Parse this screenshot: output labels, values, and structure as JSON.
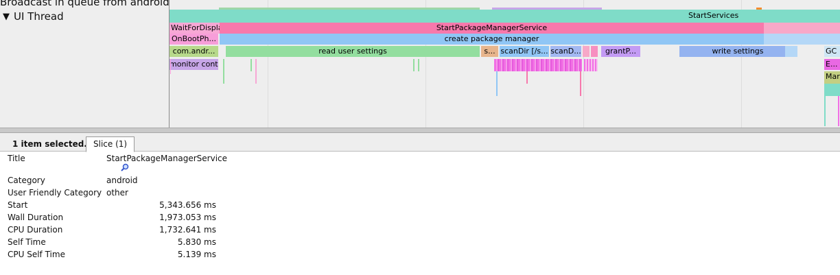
{
  "track_header": {
    "previous_track_label": "Broadcast in queue from android (",
    "thread_toggle": "▼",
    "thread_name": "UI Thread"
  },
  "slices": {
    "start_services": "StartServices",
    "wait_for_display": "WaitForDisplay",
    "start_package_manager_service": "StartPackageManagerService",
    "on_boot_phase": "OnBootPh...",
    "create_package_manager": "create package manager",
    "com_android": "com.andr...",
    "read_user_settings": "read user settings",
    "s_short": "s...",
    "scan_dir_1": "scanDir [/s...",
    "scan_dir_2": "scanD...",
    "grant_p": "grantP...",
    "write_settings": "write settings",
    "gc": "GC",
    "monitor_contention": "monitor cont...",
    "e_short": "E...",
    "mar": "Mar"
  },
  "colors": {
    "start_services": "#7fdcc8",
    "start_package_manager_service": "#f779ac",
    "create_package_manager": "#90c6f5",
    "read_user_settings": "#93de9f",
    "com_android": "#b7d98b",
    "grant_p": "#c39bf4",
    "write_settings": "#94b3f0",
    "on_boot_phase": "#f79ed9",
    "monitor_contention": "#c7a6e8",
    "scan_dir_1": "#90c6f5",
    "scan_dir_2": "#a3b8f2",
    "s_short": "#e7b58c",
    "e_short": "#e968e3",
    "mar": "#c3cf82"
  },
  "analysis": {
    "selection_summary": "1 item selected.",
    "tab_label": "Slice (1)",
    "rows": {
      "title": {
        "key": "Title",
        "value": "StartPackageManagerService"
      },
      "category": {
        "key": "Category",
        "value": "android"
      },
      "user_friendly_category": {
        "key": "User Friendly Category",
        "value": "other"
      },
      "start": {
        "key": "Start",
        "value": "5,343.656 ms"
      },
      "wall_duration": {
        "key": "Wall Duration",
        "value": "1,973.053 ms"
      },
      "cpu_duration": {
        "key": "CPU Duration",
        "value": "1,732.641 ms"
      },
      "self_time": {
        "key": "Self Time",
        "value": "5.830 ms"
      },
      "cpu_self_time": {
        "key": "CPU Self Time",
        "value": "5.139 ms"
      }
    }
  }
}
